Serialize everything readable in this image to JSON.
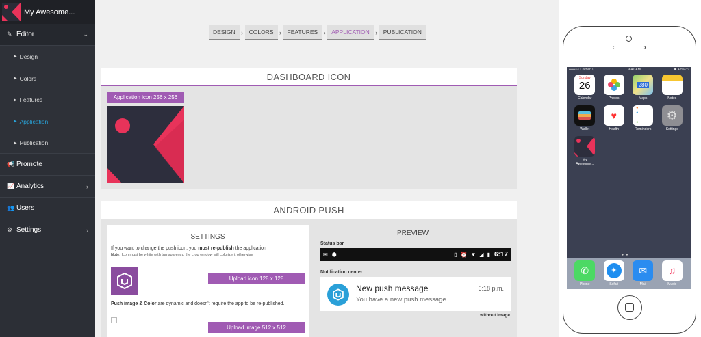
{
  "sidebar": {
    "brand": "My Awesome...",
    "editor": {
      "label": "Editor",
      "icon": "pencil-icon"
    },
    "sub_items": [
      {
        "label": "Design"
      },
      {
        "label": "Colors"
      },
      {
        "label": "Features"
      },
      {
        "label": "Application",
        "active": true
      },
      {
        "label": "Publication"
      }
    ],
    "promote": {
      "label": "Promote",
      "icon": "megaphone-icon"
    },
    "analytics": {
      "label": "Analytics",
      "icon": "chart-icon"
    },
    "users": {
      "label": "Users",
      "icon": "users-icon"
    },
    "settings": {
      "label": "Settings",
      "icon": "gears-icon"
    },
    "active_color": "#29a3d9"
  },
  "steps": {
    "design": "DESIGN",
    "colors": "COLORS",
    "features": "FEATURES",
    "application": "APPLICATION",
    "publication": "PUBLICATION",
    "active": "APPLICATION"
  },
  "dashboard": {
    "title": "DASHBOARD ICON",
    "icon_button": "Application icon 256 x 256"
  },
  "android": {
    "title": "ANDROID PUSH",
    "settings": {
      "title": "SETTINGS",
      "desc_prefix": "If you want to change the push icon, you ",
      "desc_bold": "must re-publish",
      "desc_suffix": " the application",
      "note_bold": "Note:",
      "note_text": " Icon must be white with transparency, the crop window will colorize it otherwise",
      "upload_128": "Upload icon 128 x 128",
      "push_bold": "Push image & Color",
      "push_text": " are dynamic and doesn't require the app to be re-published.",
      "upload_512": "Upload image 512 x 512"
    },
    "preview": {
      "title": "PREVIEW",
      "status_label": "Status bar",
      "status_time": "6:17",
      "notif_label": "Notification center",
      "notif_title": "New push message",
      "notif_body": "You have a new push message",
      "notif_time": "6:18 p.m.",
      "without_image": "without image"
    }
  },
  "phone": {
    "carrier": "Carrier",
    "time": "9:41 AM",
    "battery": "42%",
    "calendar_day": "Sunday",
    "calendar_date": "26",
    "apps": [
      {
        "label": "Calendar",
        "icon": "calendar-icon"
      },
      {
        "label": "Photos",
        "icon": "photos-icon"
      },
      {
        "label": "Maps",
        "icon": "maps-icon"
      },
      {
        "label": "Notes",
        "icon": "notes-icon"
      },
      {
        "label": "Wallet",
        "icon": "wallet-icon"
      },
      {
        "label": "Health",
        "icon": "health-icon"
      },
      {
        "label": "Reminders",
        "icon": "reminders-icon"
      },
      {
        "label": "Settings",
        "icon": "settings-icon"
      },
      {
        "label": "My\nAwesome...",
        "icon": "app-icon"
      }
    ],
    "dock": [
      {
        "label": "Phone",
        "icon": "phone-icon"
      },
      {
        "label": "Safari",
        "icon": "safari-icon"
      },
      {
        "label": "Mail",
        "icon": "mail-icon"
      },
      {
        "label": "Music",
        "icon": "music-icon"
      }
    ]
  },
  "colors": {
    "accent": "#a05bb3",
    "sidebar_bg": "#2c2f36",
    "brand_pink": "#e8335a"
  }
}
